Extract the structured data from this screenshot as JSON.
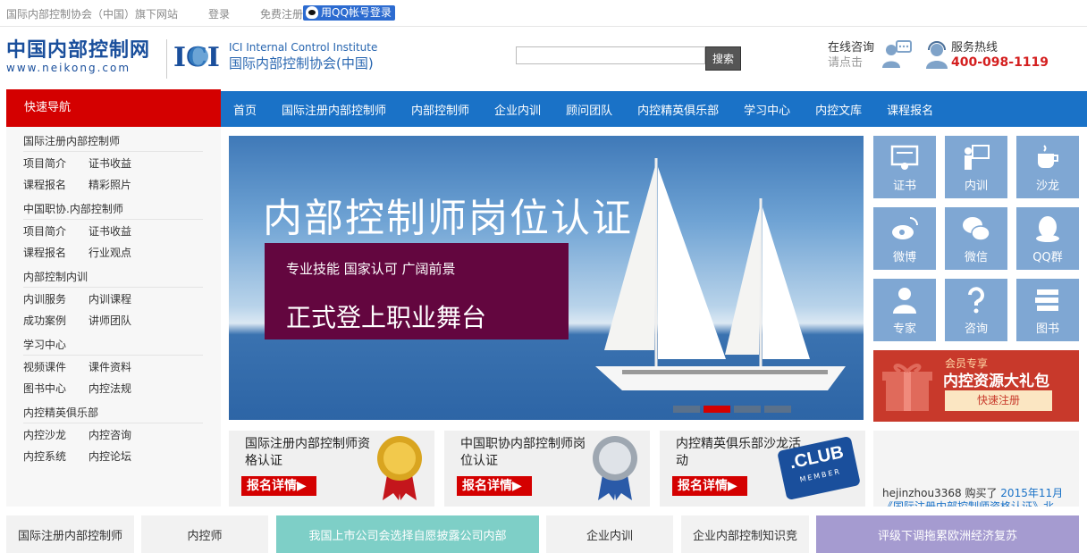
{
  "topbar": {
    "site": "国际内部控制协会（中国）旗下网站",
    "login": "登录",
    "register": "免费注册",
    "qq_login": "用QQ帐号登录"
  },
  "header": {
    "logo_cn": "中国内部控制网",
    "logo_en": "www.neikong.com",
    "ici_en": "ICI Internal Control Institute",
    "ici_cn": "国际内部控制协会(中国)",
    "search_placeholder": "",
    "search_button": "搜索",
    "consult_label": "在线咨询",
    "consult_sub": "请点击",
    "hotline_label": "服务热线",
    "hotline_number": "400-098-1119"
  },
  "nav": {
    "quick_nav": "快速导航",
    "items": [
      "首页",
      "国际注册内部控制师",
      "内部控制师",
      "企业内训",
      "顾问团队",
      "内控精英俱乐部",
      "学习中心",
      "内控文库",
      "课程报名"
    ]
  },
  "sidebar": {
    "groups": [
      {
        "title": "国际注册内部控制师",
        "rows": [
          [
            "项目简介",
            "证书收益"
          ],
          [
            "课程报名",
            "精彩照片"
          ]
        ]
      },
      {
        "title": "中国职协.内部控制师",
        "rows": [
          [
            "项目简介",
            "证书收益"
          ],
          [
            "课程报名",
            "行业观点"
          ]
        ]
      },
      {
        "title": "内部控制内训",
        "rows": [
          [
            "内训服务",
            "内训课程"
          ],
          [
            "成功案例",
            "讲师团队"
          ]
        ]
      },
      {
        "title": "学习中心",
        "rows": [
          [
            "视频课件",
            "课件资料"
          ],
          [
            "图书中心",
            "内控法规"
          ]
        ]
      },
      {
        "title": "内控精英俱乐部",
        "rows": [
          [
            "内控沙龙",
            "内控咨询"
          ],
          [
            "内控系统",
            "内控论坛"
          ]
        ]
      }
    ]
  },
  "banner": {
    "title": "内部控制师岗位认证",
    "tagline": "专业技能  国家认可  广阔前景",
    "slogan": "正式登上职业舞台"
  },
  "tiles": [
    "证书",
    "内训",
    "沙龙",
    "微博",
    "微信",
    "QQ群",
    "专家",
    "咨询",
    "图书"
  ],
  "gift": {
    "small": "会员专享",
    "big": "内控资源大礼包",
    "button": "快速注册"
  },
  "cards": [
    {
      "title": "国际注册内部控制师资格认证",
      "button": "报名详情▶"
    },
    {
      "title": "中国职协内部控制师岗位认证",
      "button": "报名详情▶"
    },
    {
      "title": "内控精英俱乐部沙龙活动",
      "button": "报名详情▶"
    }
  ],
  "card_badge": ".CLUB",
  "card_badge_sub": "MEMBER",
  "purchase": {
    "text": "hejinzhou3368 购买了 ",
    "date": "2015年11月",
    "item": "《国际注册内部控制师资格认证》北"
  },
  "bottom": [
    "国际注册内部控制师",
    "内控师",
    "我国上市公司会选择自愿披露公司内部",
    "企业内训",
    "企业内部控制知识竞",
    "评级下调拖累欧洲经济复苏"
  ]
}
